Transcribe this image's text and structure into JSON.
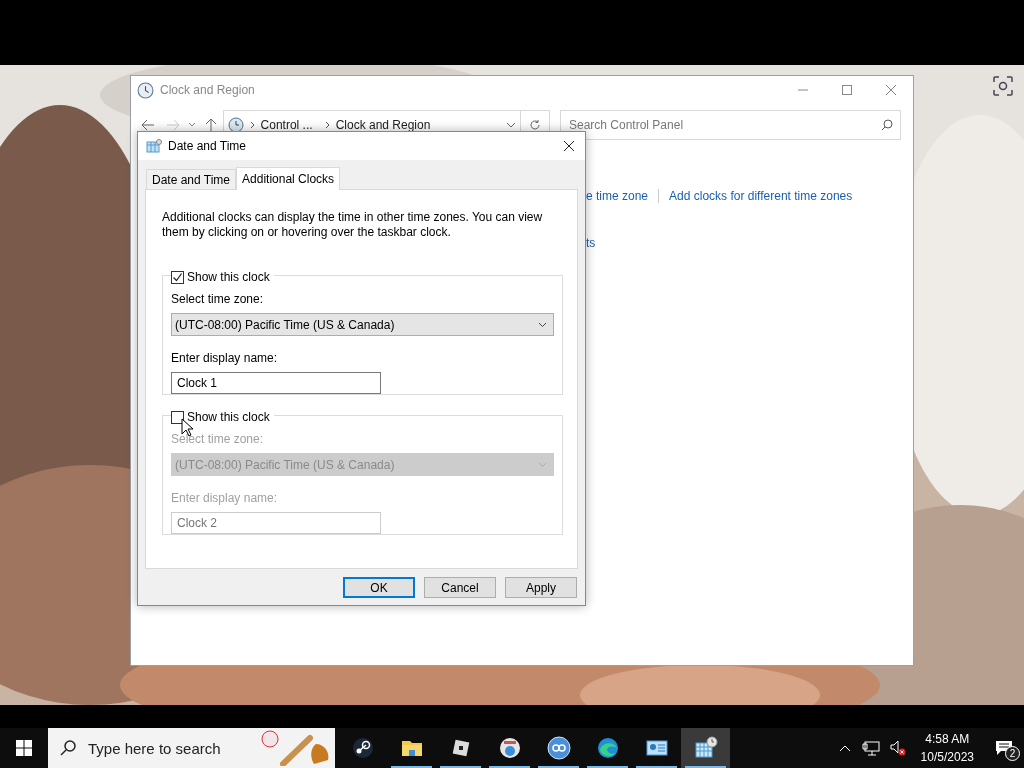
{
  "control_panel": {
    "title": "Clock and Region",
    "breadcrumb": [
      "Control ...",
      "Clock and Region"
    ],
    "search": {
      "placeholder": "Search Control Panel"
    },
    "links": [
      "e time zone",
      "Add clocks for different time zones",
      "ts"
    ]
  },
  "dialog": {
    "title": "Date and Time",
    "tabs": [
      {
        "label": "Date and Time",
        "selected": false
      },
      {
        "label": "Additional Clocks",
        "selected": true
      }
    ],
    "description": "Additional clocks can display the time in other time zones. You can view them by clicking on or hovering over the taskbar clock.",
    "clocks": [
      {
        "show_label": "Show this clock",
        "checked": true,
        "timezone_label": "Select time zone:",
        "timezone": "(UTC-08:00) Pacific Time (US & Canada)",
        "name_label": "Enter display name:",
        "display_name": "Clock 1"
      },
      {
        "show_label": "Show this clock",
        "checked": false,
        "timezone_label": "Select time zone:",
        "timezone": "(UTC-08:00) Pacific Time (US & Canada)",
        "name_label": "Enter display name:",
        "display_name": "Clock 2"
      }
    ],
    "buttons": [
      {
        "label": "OK",
        "default": true
      },
      {
        "label": "Cancel",
        "default": false
      },
      {
        "label": "Apply",
        "default": false
      }
    ]
  },
  "taskbar": {
    "search": {
      "placeholder": "Type here to search"
    },
    "apps": [
      {
        "kind": "steam",
        "running": false,
        "selected": false
      },
      {
        "kind": "folder",
        "running": true,
        "selected": false
      },
      {
        "kind": "cube",
        "running": true,
        "selected": false
      },
      {
        "kind": "globe",
        "running": true,
        "selected": false
      },
      {
        "kind": "qb",
        "running": true,
        "selected": false
      },
      {
        "kind": "edge",
        "running": true,
        "selected": false
      },
      {
        "kind": "panel",
        "running": true,
        "selected": false
      },
      {
        "kind": "calendar",
        "running": true,
        "selected": true
      }
    ],
    "time": "4:58 AM",
    "date": "10/5/2023",
    "notifications": "2"
  }
}
